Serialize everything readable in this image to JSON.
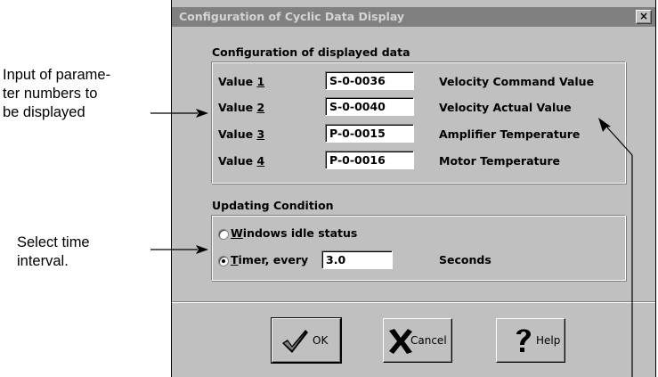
{
  "annotations": {
    "input_params": [
      "Input of parame-",
      "ter numbers to",
      "be displayed"
    ],
    "select_time": [
      "Select time",
      "interval."
    ]
  },
  "dialog": {
    "title": "Configuration of Cyclic Data Display",
    "close_label": "×",
    "data_group": {
      "label": "Configuration of displayed data",
      "rows": [
        {
          "label_prefix": "Value ",
          "label_key": "1",
          "param": "S-0-0036",
          "description": "Velocity Command Value"
        },
        {
          "label_prefix": "Value ",
          "label_key": "2",
          "param": "S-0-0040",
          "description": "Velocity Actual Value"
        },
        {
          "label_prefix": "Value ",
          "label_key": "3",
          "param": "P-0-0015",
          "description": "Amplifier Temperature"
        },
        {
          "label_prefix": "Value ",
          "label_key": "4",
          "param": "P-0-0016",
          "description": "Motor Temperature"
        }
      ]
    },
    "update_group": {
      "label": "Updating Condition",
      "idle_key": "W",
      "idle_rest": "indows idle status",
      "timer_key": "T",
      "timer_rest": "imer, every",
      "timer_value": "3.0",
      "timer_unit": "Seconds",
      "selected": "timer"
    },
    "buttons": {
      "ok": "OK",
      "cancel": "Cancel",
      "help": "Help"
    }
  }
}
